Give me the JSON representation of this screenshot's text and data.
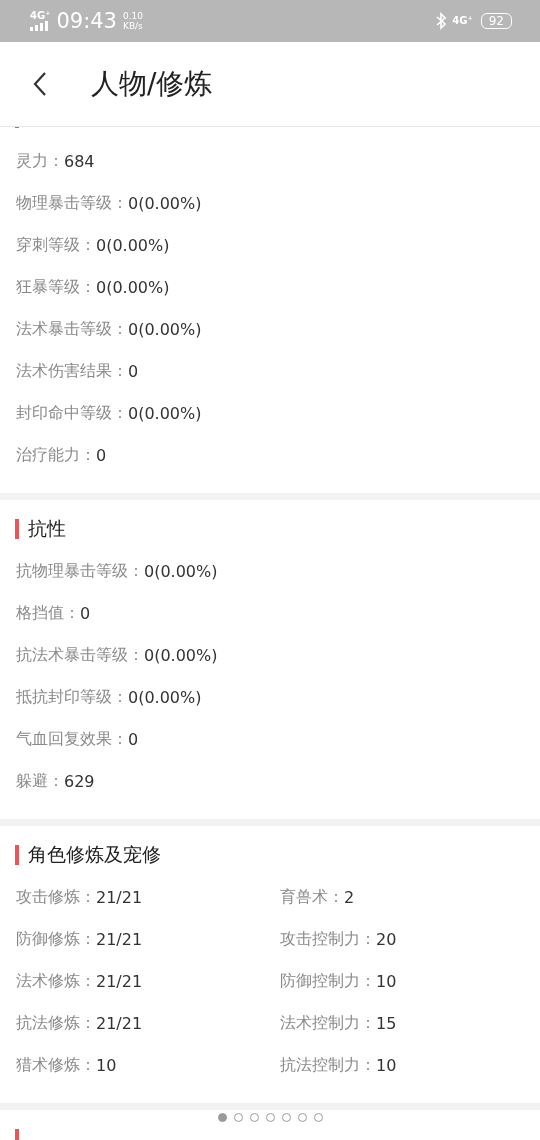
{
  "status_bar": {
    "network": "4G⁺",
    "time": "09:43",
    "speed": "0.10",
    "speed_unit": "KB/s",
    "network_right": "4G⁺",
    "battery": "92"
  },
  "header": {
    "title": "人物/修炼"
  },
  "sections": [
    {
      "kind": "list",
      "rows": [
        {
          "label": "灵力：",
          "value": "684"
        },
        {
          "label": "物理暴击等级：",
          "value": "0(0.00%)"
        },
        {
          "label": "穿刺等级：",
          "value": "0(0.00%)"
        },
        {
          "label": "狂暴等级：",
          "value": "0(0.00%)"
        },
        {
          "label": "法术暴击等级：",
          "value": "0(0.00%)"
        },
        {
          "label": "法术伤害结果：",
          "value": "0"
        },
        {
          "label": "封印命中等级：",
          "value": "0(0.00%)"
        },
        {
          "label": "治疗能力：",
          "value": "0"
        }
      ]
    },
    {
      "title": "抗性",
      "kind": "list",
      "rows": [
        {
          "label": "抗物理暴击等级：",
          "value": "0(0.00%)"
        },
        {
          "label": "格挡值：",
          "value": "0"
        },
        {
          "label": "抗法术暴击等级：",
          "value": "0(0.00%)"
        },
        {
          "label": "抵抗封印等级：",
          "value": "0(0.00%)"
        },
        {
          "label": "气血回复效果：",
          "value": "0"
        },
        {
          "label": "躲避：",
          "value": "629"
        }
      ]
    },
    {
      "title": "角色修炼及宠修",
      "kind": "grid",
      "rows": [
        {
          "label": "攻击修炼：",
          "value": "21/21"
        },
        {
          "label": "育兽术：",
          "value": "2"
        },
        {
          "label": "防御修炼：",
          "value": "21/21"
        },
        {
          "label": "攻击控制力：",
          "value": "20"
        },
        {
          "label": "法术修炼：",
          "value": "21/21"
        },
        {
          "label": "防御控制力：",
          "value": "10"
        },
        {
          "label": "抗法修炼：",
          "value": "21/21"
        },
        {
          "label": "法术控制力：",
          "value": "15"
        },
        {
          "label": "猎术修炼：",
          "value": "10"
        },
        {
          "label": "抗法控制力：",
          "value": "10"
        }
      ]
    },
    {
      "kind": "list"
    }
  ],
  "pager": [
    {
      "selected": true
    },
    {
      "selected": false
    },
    {
      "selected": false
    },
    {
      "selected": false
    },
    {
      "selected": false
    },
    {
      "selected": false
    },
    {
      "selected": false
    }
  ]
}
